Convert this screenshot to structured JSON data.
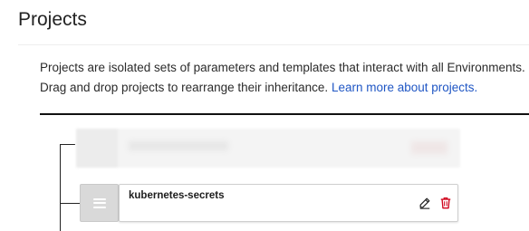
{
  "header": {
    "title": "Projects"
  },
  "description": {
    "line1": "Projects are isolated sets of parameters and templates that interact with all Environments.",
    "line2_text": "Drag and drop projects to rearrange their inheritance. ",
    "link_text": "Learn more about projects."
  },
  "projects": [
    {
      "name": "kubernetes-secrets"
    }
  ],
  "icons": {
    "drag": "drag-handle-icon",
    "edit": "pencil-icon",
    "delete": "trash-icon"
  },
  "colors": {
    "link": "#1f56c4",
    "delete": "#d0021b",
    "handle_bg": "#d9d9d9"
  }
}
